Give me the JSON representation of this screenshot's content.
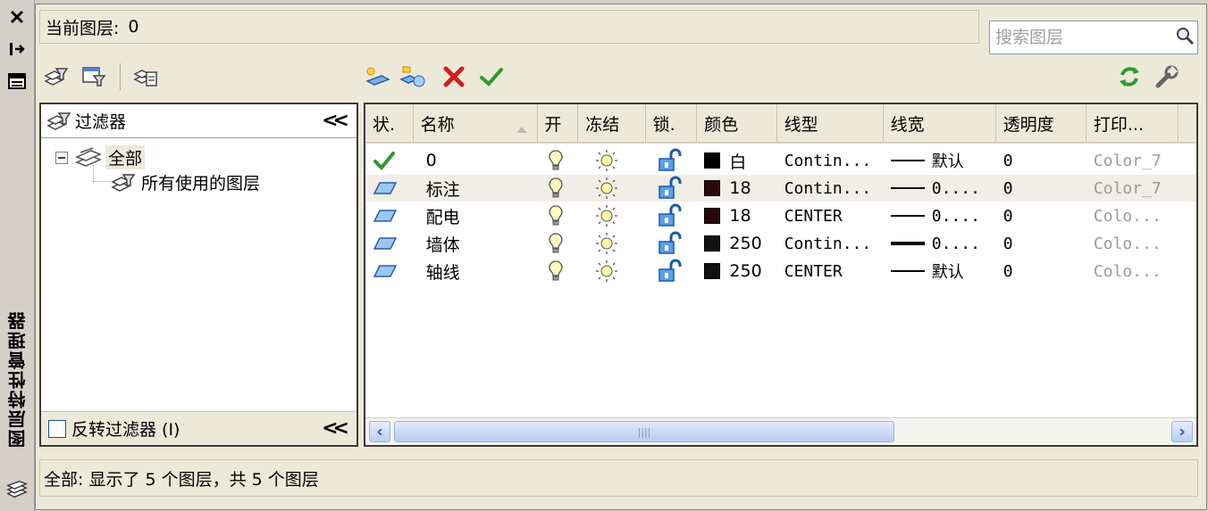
{
  "palette": {
    "title": "图层特性管理器"
  },
  "current_layer": {
    "label": "当前图层:",
    "value": "0"
  },
  "search": {
    "placeholder": "搜索图层"
  },
  "toolbar": {
    "left_icons": [
      "new-property-filter-icon",
      "new-group-filter-icon",
      "layer-states-manager-icon"
    ],
    "layer_icons": [
      "new-layer-icon",
      "new-layer-frozen-in-viewports-icon",
      "delete-layer-icon",
      "set-current-icon"
    ],
    "right_icons": [
      "refresh-icon",
      "settings-icon"
    ]
  },
  "filters": {
    "header": "过滤器",
    "tree": [
      {
        "label": "全部",
        "selected": true
      },
      {
        "label": "所有使用的图层",
        "selected": false
      }
    ],
    "invert_label": "反转过滤器 (I)"
  },
  "columns": {
    "status": "状.",
    "name": "名称",
    "on": "开",
    "freeze": "冻结",
    "lock": "锁.",
    "color": "颜色",
    "linetype": "线型",
    "lineweight": "线宽",
    "transparency": "透明度",
    "plot_style": "打印..."
  },
  "layers": [
    {
      "status": "current",
      "name": "0",
      "color": "白",
      "color_hex": "#000000",
      "linetype": "Contin...",
      "lineweight": "默认",
      "transparency": "0",
      "plot_style": "Color_7"
    },
    {
      "status": "layer",
      "name": "标注",
      "color": "18",
      "color_hex": "#2a0808",
      "linetype": "Contin...",
      "lineweight": "0....",
      "transparency": "0",
      "plot_style": "Color_7"
    },
    {
      "status": "layer",
      "name": "配电",
      "color": "18",
      "color_hex": "#2a0808",
      "linetype": "CENTER",
      "lineweight": "0....",
      "transparency": "0",
      "plot_style": "Colo..."
    },
    {
      "status": "layer",
      "name": "墙体",
      "color": "250",
      "color_hex": "#111111",
      "linetype": "Contin...",
      "lineweight": "0....",
      "transparency": "0",
      "plot_style": "Colo..."
    },
    {
      "status": "layer",
      "name": "轴线",
      "color": "250",
      "color_hex": "#111111",
      "linetype": "CENTER",
      "lineweight": "默认",
      "transparency": "0",
      "plot_style": "Colo..."
    }
  ],
  "status_bar": {
    "text": "全部: 显示了 5 个图层，共 5 个图层"
  }
}
